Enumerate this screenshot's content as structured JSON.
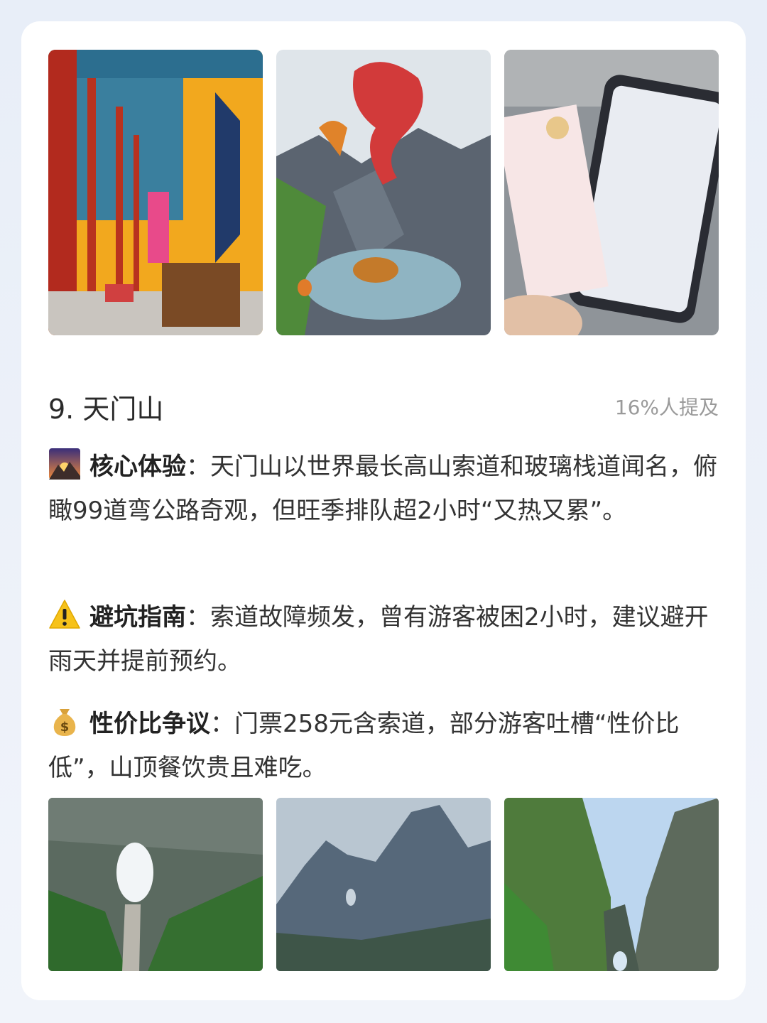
{
  "section": {
    "title": "9. 天门山",
    "mention": "16%人提及"
  },
  "paragraphs": [
    {
      "icon": "sunrise-mountain-icon",
      "lead": "核心体验",
      "sep": "：",
      "text": "天门山以世界最长高山索道和玻璃栈道闻名，俯瞰99道弯公路奇观，但旺季排队超2小时“又热又累”。"
    },
    {
      "icon": "warning-icon",
      "lead": "避坑指南",
      "sep": "：",
      "text": "索道故障频发，曾有游客被困2小时，建议避开雨天并提前预约。"
    },
    {
      "icon": "money-bag-icon",
      "lead": "性价比争议",
      "sep": "：",
      "text": "门票258元含索道，部分游客吐槽“性价比低”，山顶餐饮贵且难吃。"
    }
  ],
  "colors": {
    "page_bg": "#e8eef8",
    "card_bg": "#ffffff",
    "title": "#2a2a2a",
    "mention": "#9a9a9a",
    "body_text": "#333333"
  }
}
